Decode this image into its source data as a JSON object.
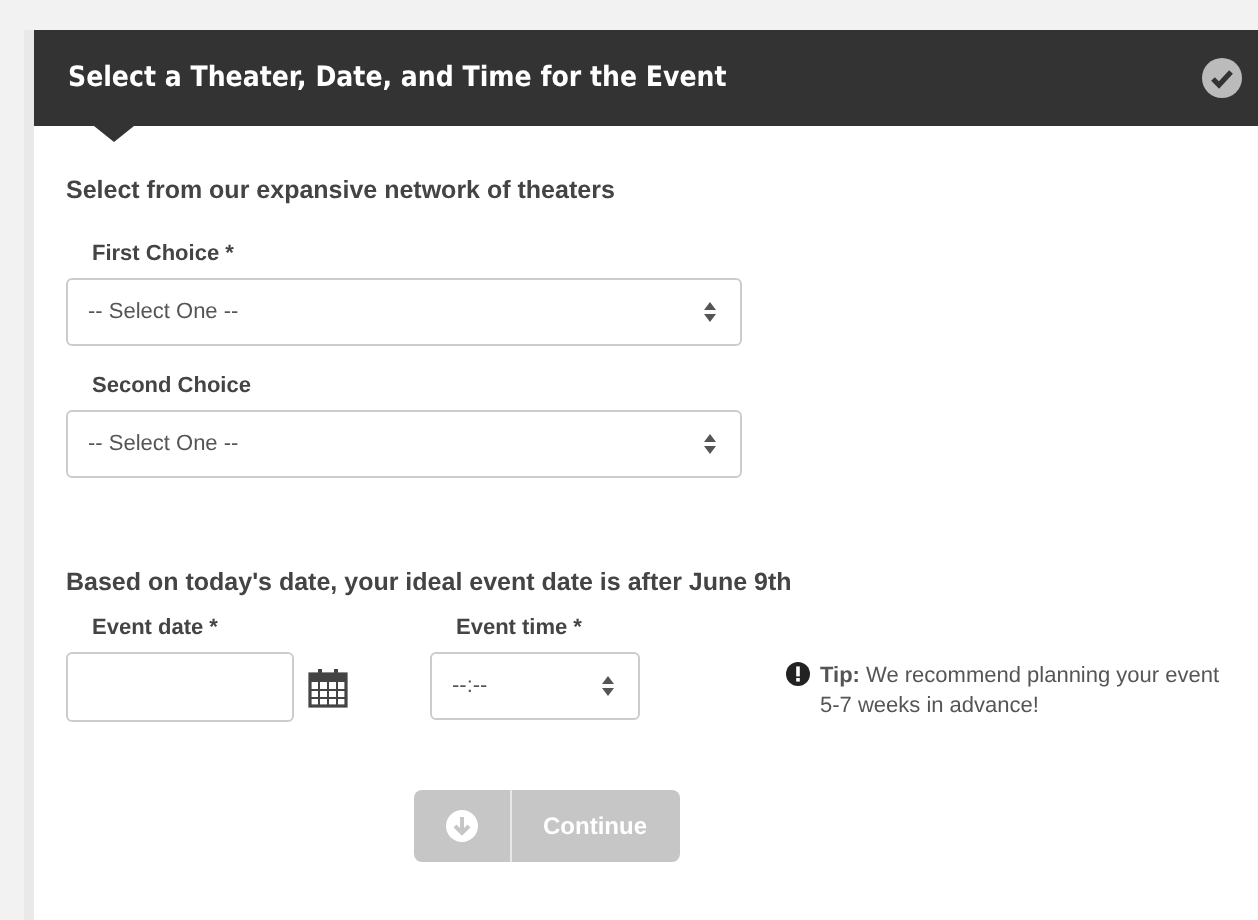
{
  "header": {
    "title": "Select a Theater, Date, and Time for the Event"
  },
  "theaters": {
    "heading": "Select from our expansive network of theaters",
    "choices": [
      {
        "label": "First Choice *",
        "value": "-- Select One --"
      },
      {
        "label": "Second Choice",
        "value": "-- Select One --"
      }
    ]
  },
  "schedule": {
    "heading": "Based on today's date, your ideal event date is after June 9th",
    "date": {
      "label": "Event date *"
    },
    "time": {
      "label": "Event time *",
      "value": "--:--"
    },
    "tip": "**Tip:** We recommend planning your event 5-7 weeks in advance!"
  },
  "continue_button": {
    "label": "Continue",
    "disabled": true
  }
}
